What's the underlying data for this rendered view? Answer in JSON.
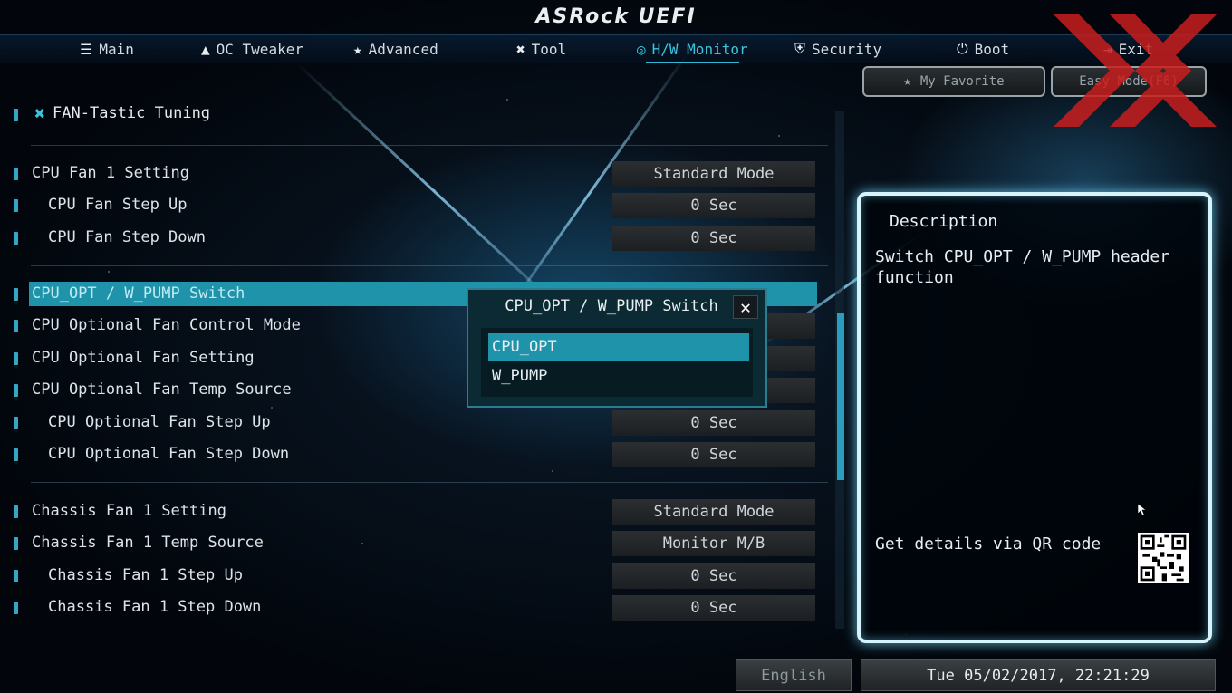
{
  "logo": "ASRock UEFI",
  "tabs": [
    {
      "label": "Main",
      "icon": "list-icon"
    },
    {
      "label": "OC Tweaker",
      "icon": "rocket-icon"
    },
    {
      "label": "Advanced",
      "icon": "star-icon"
    },
    {
      "label": "Tool",
      "icon": "tools-icon"
    },
    {
      "label": "H/W Monitor",
      "icon": "monitor-icon"
    },
    {
      "label": "Security",
      "icon": "shield-icon"
    },
    {
      "label": "Boot",
      "icon": "power-icon"
    },
    {
      "label": "Exit",
      "icon": "exit-icon"
    }
  ],
  "active_tab": "H/W Monitor",
  "buttons": {
    "favorite": "My Favorite",
    "easy_mode": "Easy Mode(F6)"
  },
  "section": {
    "title": "FAN-Tastic Tuning"
  },
  "settings": [
    {
      "label": "CPU Fan 1 Setting",
      "value": "Standard Mode"
    },
    {
      "label": "CPU Fan Step Up",
      "value": "0 Sec"
    },
    {
      "label": "CPU Fan Step Down",
      "value": "0 Sec"
    },
    {
      "label": "CPU_OPT / W_PUMP Switch",
      "value": ""
    },
    {
      "label": "CPU Optional Fan Control Mode",
      "value": ""
    },
    {
      "label": "CPU Optional Fan Setting",
      "value": ""
    },
    {
      "label": "CPU Optional Fan Temp Source",
      "value": ""
    },
    {
      "label": "CPU Optional Fan Step Up",
      "value": "0 Sec"
    },
    {
      "label": "CPU Optional Fan Step Down",
      "value": "0 Sec"
    },
    {
      "label": "Chassis Fan 1 Setting",
      "value": "Standard Mode"
    },
    {
      "label": "Chassis Fan 1 Temp Source",
      "value": "Monitor M/B"
    },
    {
      "label": "Chassis Fan 1 Step Up",
      "value": "0 Sec"
    },
    {
      "label": "Chassis Fan 1 Step Down",
      "value": "0 Sec"
    }
  ],
  "dialog": {
    "title": "CPU_OPT / W_PUMP Switch",
    "close": "✕",
    "options": [
      "CPU_OPT",
      "W_PUMP"
    ],
    "selected": "CPU_OPT"
  },
  "description": {
    "heading": "Description",
    "text": "Switch CPU_OPT / W_PUMP header function",
    "qr_text": "Get details via QR code"
  },
  "footer": {
    "language": "English",
    "datetime": "Tue 05/02/2017, 22:21:29"
  },
  "colors": {
    "accent": "#1f93aa",
    "active_tab": "#3cc4dc",
    "panel_glow": "#d8f4fb",
    "watermark": "#c81e1e"
  }
}
